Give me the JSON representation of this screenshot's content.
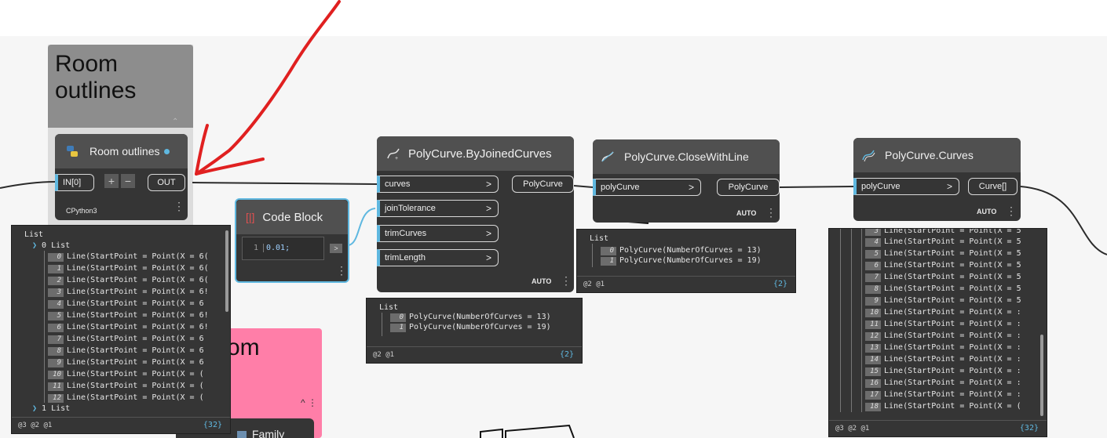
{
  "groups": {
    "room_outlines": {
      "title": "Room\noutlines",
      "color": "#8d8d8d"
    },
    "pink": {
      "title": "om",
      "color": "#ff7ea8",
      "family_label": "Family Name"
    }
  },
  "nodes": {
    "python": {
      "title": "Room outlines",
      "input": "IN[0]",
      "plus": "+",
      "minus": "−",
      "output": "OUT",
      "engine": "CPython3",
      "dot_color": "#5fb8e0"
    },
    "code_block": {
      "title": "Code Block",
      "line_no": "1",
      "code": "0.01;",
      "out": ">"
    },
    "joined": {
      "title": "PolyCurve.ByJoinedCurves",
      "inputs": [
        "curves",
        "joinTolerance",
        "trimCurves",
        "trimLength"
      ],
      "output": "PolyCurve",
      "lacing": "AUTO"
    },
    "close": {
      "title": "PolyCurve.CloseWithLine",
      "input": "polyCurve",
      "output": "PolyCurve",
      "lacing": "AUTO"
    },
    "curves": {
      "title": "PolyCurve.Curves",
      "input": "polyCurve",
      "output": "Curve[]",
      "lacing": "AUTO"
    }
  },
  "previews": {
    "python": {
      "header": "List",
      "sub": "0 List",
      "items": [
        {
          "i": "0",
          "t": "Line(StartPoint = Point(X = 6("
        },
        {
          "i": "1",
          "t": "Line(StartPoint = Point(X = 6("
        },
        {
          "i": "2",
          "t": "Line(StartPoint = Point(X = 6("
        },
        {
          "i": "3",
          "t": "Line(StartPoint = Point(X = 6!"
        },
        {
          "i": "4",
          "t": "Line(StartPoint = Point(X = 6"
        },
        {
          "i": "5",
          "t": "Line(StartPoint = Point(X = 6!"
        },
        {
          "i": "6",
          "t": "Line(StartPoint = Point(X = 6!"
        },
        {
          "i": "7",
          "t": "Line(StartPoint = Point(X = 6"
        },
        {
          "i": "8",
          "t": "Line(StartPoint = Point(X = 6"
        },
        {
          "i": "9",
          "t": "Line(StartPoint = Point(X = 6"
        },
        {
          "i": "10",
          "t": "Line(StartPoint = Point(X = ("
        },
        {
          "i": "11",
          "t": "Line(StartPoint = Point(X = ("
        },
        {
          "i": "12",
          "t": "Line(StartPoint = Point(X = ("
        }
      ],
      "tail": "1 List",
      "levels": "@3 @2 @1",
      "count": "{32}"
    },
    "joined": {
      "header": "List",
      "items": [
        {
          "i": "0",
          "t": "PolyCurve(NumberOfCurves = 13)"
        },
        {
          "i": "1",
          "t": "PolyCurve(NumberOfCurves = 19)"
        }
      ],
      "levels": "@2 @1",
      "count": "{2}"
    },
    "close": {
      "header": "List",
      "items": [
        {
          "i": "0",
          "t": "PolyCurve(NumberOfCurves = 13)"
        },
        {
          "i": "1",
          "t": "PolyCurve(NumberOfCurves = 19)"
        }
      ],
      "levels": "@2 @1",
      "count": "{2}"
    },
    "curves": {
      "top_partial": "Line(StartPoint = Point(X = 5",
      "items": [
        {
          "i": "4",
          "t": "Line(StartPoint = Point(X = 5"
        },
        {
          "i": "5",
          "t": "Line(StartPoint = Point(X = 5"
        },
        {
          "i": "6",
          "t": "Line(StartPoint = Point(X = 5"
        },
        {
          "i": "7",
          "t": "Line(StartPoint = Point(X = 5"
        },
        {
          "i": "8",
          "t": "Line(StartPoint = Point(X = 5"
        },
        {
          "i": "9",
          "t": "Line(StartPoint = Point(X = 5"
        },
        {
          "i": "10",
          "t": "Line(StartPoint = Point(X = :"
        },
        {
          "i": "11",
          "t": "Line(StartPoint = Point(X = :"
        },
        {
          "i": "12",
          "t": "Line(StartPoint = Point(X = :"
        },
        {
          "i": "13",
          "t": "Line(StartPoint = Point(X = :"
        },
        {
          "i": "14",
          "t": "Line(StartPoint = Point(X = :"
        },
        {
          "i": "15",
          "t": "Line(StartPoint = Point(X = :"
        },
        {
          "i": "16",
          "t": "Line(StartPoint = Point(X = :"
        },
        {
          "i": "17",
          "t": "Line(StartPoint = Point(X = :"
        },
        {
          "i": "18",
          "t": "Line(StartPoint = Point(X = ("
        }
      ],
      "levels": "@3 @2 @1",
      "count": "{32}"
    }
  },
  "colors": {
    "wire": "#2b2b2b",
    "annotation": "#e02020",
    "accent": "#5fb8e0"
  }
}
